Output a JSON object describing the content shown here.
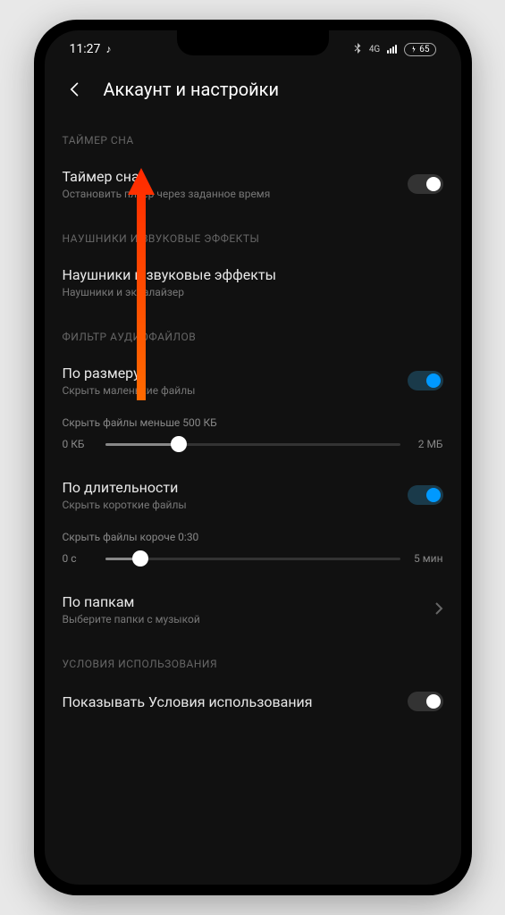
{
  "status_bar": {
    "time": "11:27",
    "music_icon": "♪",
    "network_label": "4G",
    "battery": "65"
  },
  "header": {
    "title": "Аккаунт и настройки"
  },
  "sections": {
    "sleep_timer": {
      "header": "ТАЙМЕР СНА",
      "title": "Таймер сна",
      "subtitle": "Остановить плеер через заданное время"
    },
    "headphones": {
      "header": "НАУШНИКИ И ЗВУКОВЫЕ ЭФФЕКТЫ",
      "title": "Наушники и звуковые эффекты",
      "subtitle": "Наушники и эквалайзер"
    },
    "filter": {
      "header": "ФИЛЬТР АУДИОФАЙЛОВ",
      "by_size": {
        "title": "По размеру",
        "subtitle": "Скрыть маленькие файлы",
        "slider_label": "Скрыть файлы меньше 500 КБ",
        "min": "0 КБ",
        "max": "2 МБ"
      },
      "by_duration": {
        "title": "По длительности",
        "subtitle": "Скрыть короткие файлы",
        "slider_label": "Скрыть файлы короче 0:30",
        "min": "0 с",
        "max": "5 мин"
      },
      "by_folder": {
        "title": "По папкам",
        "subtitle": "Выберите папки с музыкой"
      }
    },
    "terms": {
      "header": "УСЛОВИЯ ИСПОЛЬЗОВАНИЯ",
      "title": "Показывать Условия использования"
    }
  },
  "colors": {
    "accent": "#0099ff",
    "arrow": "#ff3a1f"
  }
}
